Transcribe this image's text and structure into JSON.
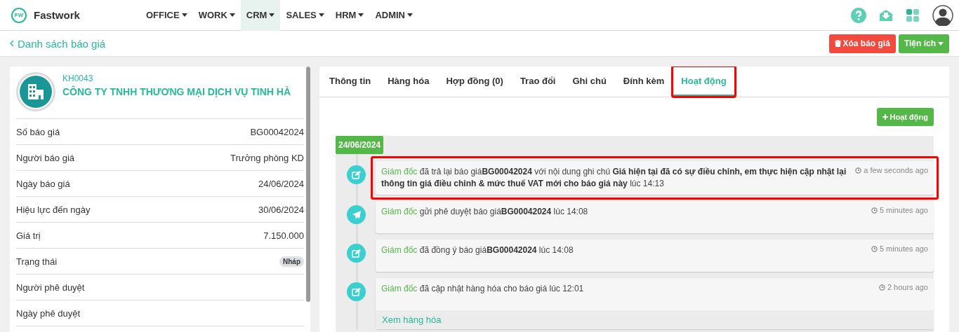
{
  "header": {
    "brand": "Fastwork",
    "logo": "FW",
    "menu": [
      {
        "label": "OFFICE",
        "selected": false
      },
      {
        "label": "WORK",
        "selected": false
      },
      {
        "label": "CRM",
        "selected": true
      },
      {
        "label": "SALES",
        "selected": false
      },
      {
        "label": "HRM",
        "selected": false
      },
      {
        "label": "ADMIN",
        "selected": false
      }
    ]
  },
  "subbar": {
    "back": "Danh sách báo giá",
    "buttons": [
      {
        "label": "Xóa báo giá",
        "kind": "delete"
      },
      {
        "label": "Tiện ích",
        "kind": "dropdown"
      }
    ]
  },
  "customer": {
    "code": "KH0043",
    "name": "CÔNG TY TNHH THƯƠNG MẠI DỊCH VỤ TINH HÀ"
  },
  "fields": [
    {
      "label": "Số báo giá",
      "value": "BG00042024"
    },
    {
      "label": "Người báo giá",
      "value": "Trưởng phòng KD"
    },
    {
      "label": "Ngày báo giá",
      "value": "24/06/2024"
    },
    {
      "label": "Hiệu lực đến ngày",
      "value": "30/06/2024"
    },
    {
      "label": "Giá trị",
      "value": "7.150.000"
    },
    {
      "label": "Trạng thái",
      "badge": "Nháp"
    },
    {
      "label": "Người phê duyệt"
    },
    {
      "label": "Ngày phê duyệt"
    }
  ],
  "tabs": [
    {
      "label": "Thông tin",
      "selected": false,
      "highlighted": false
    },
    {
      "label": "Hàng hóa",
      "selected": false,
      "highlighted": false
    },
    {
      "label": "Hợp đồng (0)",
      "selected": false,
      "highlighted": false
    },
    {
      "label": "Trao đổi",
      "selected": false,
      "highlighted": false
    },
    {
      "label": "Ghi chú",
      "selected": false,
      "highlighted": false
    },
    {
      "label": "Đính kèm",
      "selected": false,
      "highlighted": false
    },
    {
      "label": "Hoạt động",
      "selected": true,
      "highlighted": true
    }
  ],
  "add_button": "Hoạt động",
  "date": "24/06/2024",
  "activities": [
    {
      "kind": "edit",
      "actor": "Giám đốc",
      "text": "đã trả lại báo giá**BG00042024** với nội dung ghi chú **Giá hiện tại đã có sự điều chỉnh, em thực hiện cập nhật lại thông tin giá điều chỉnh & mức thuế VAT mới cho báo giá này** lúc 14:13",
      "time": "a few seconds ago",
      "highlighted": true
    },
    {
      "kind": "send",
      "actor": "Giám đốc",
      "text": "gửi phê duyệt báo giá**BG00042024** lúc 14:08",
      "time": "5 minutes ago",
      "highlighted": false
    },
    {
      "kind": "edit",
      "actor": "Giám đốc",
      "text": "đã đồng ý báo giá**BG00042024** lúc 14:08",
      "time": "5 minutes ago",
      "highlighted": false
    },
    {
      "kind": "edit",
      "actor": "Giám đốc",
      "text": "đã cập nhật hàng hóa cho báo giá lúc 12:01",
      "time": "2 hours ago",
      "highlighted": false,
      "link": "Xem hàng hóa"
    }
  ]
}
